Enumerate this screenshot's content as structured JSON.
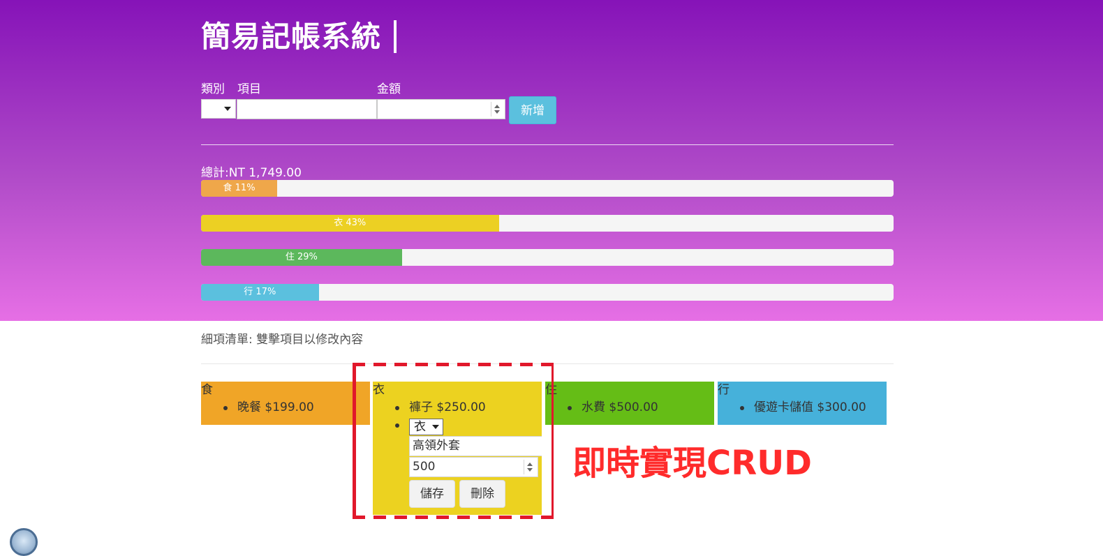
{
  "app": {
    "title": "簡易記帳系統",
    "cursor": "|"
  },
  "form": {
    "category_label": "類別",
    "item_label": "項目",
    "amount_label": "金額",
    "category_value": "",
    "item_value": "",
    "item_placeholder": "",
    "amount_value": "",
    "amount_placeholder": "",
    "add_button": "新增"
  },
  "summary": {
    "total_label": "總計:",
    "total_value": "NT 1,749.00",
    "bars": [
      {
        "category": "食",
        "percent": 11,
        "label": "食 11%",
        "color": "#efa74a"
      },
      {
        "category": "衣",
        "percent": 43,
        "label": "衣 43%",
        "color": "#ecd023"
      },
      {
        "category": "住",
        "percent": 29,
        "label": "住 29%",
        "color": "#5cb85c"
      },
      {
        "category": "行",
        "percent": 17,
        "label": "行 17%",
        "color": "#5bc0de"
      }
    ]
  },
  "details": {
    "title": "細項清單: 雙擊項目以修改內容",
    "categories": [
      {
        "name": "食",
        "color": "#f0a527",
        "items": [
          {
            "text": "晚餐 $199.00"
          }
        ]
      },
      {
        "name": "衣",
        "color": "#ecd220",
        "items": [
          {
            "text": "褲子 $250.00"
          }
        ],
        "editing": {
          "category": "衣",
          "item": "高領外套",
          "amount": "500",
          "save": "儲存",
          "delete": "刪除"
        }
      },
      {
        "name": "住",
        "color": "#65bd16",
        "items": [
          {
            "text": "水費 $500.00"
          }
        ]
      },
      {
        "name": "行",
        "color": "#46b1da",
        "items": [
          {
            "text": "優遊卡儲值 $300.00"
          }
        ]
      }
    ]
  },
  "annotation": {
    "text": "即時實現CRUD",
    "color": "#ff2b2b"
  },
  "icons": {
    "category_select_arrow": "chevron-down-icon",
    "amount_spinner": "number-spinner-icon",
    "corner_logo": "browser-logo-icon"
  },
  "theme": {
    "hero_top": "#8613b8",
    "hero_bottom": "#e66fe5",
    "primary_button": "#5bc0de"
  }
}
